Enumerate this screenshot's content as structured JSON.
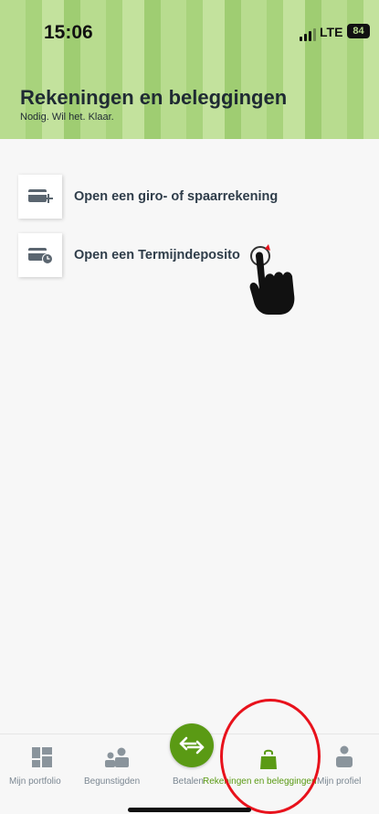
{
  "status_bar": {
    "time": "15:06",
    "network": "LTE",
    "battery": "84"
  },
  "header": {
    "title": "Rekeningen en beleggingen",
    "subtitle": "Nodig. Wil het. Klaar."
  },
  "options": [
    {
      "label": "Open een giro- of spaarrekening",
      "icon": "card-plus-icon"
    },
    {
      "label": "Open een Termijndeposito",
      "icon": "card-clock-icon"
    }
  ],
  "bottom_nav": {
    "items": [
      {
        "label": "Mijn portfolio",
        "icon": "portfolio-grid-icon"
      },
      {
        "label": "Begunstigden",
        "icon": "people-icon"
      },
      {
        "label": "Betalen",
        "icon": "transfer-arrows-icon"
      },
      {
        "label": "Rekeningen en beleggingen",
        "icon": "bag-icon",
        "active": true
      },
      {
        "label": "Mijn profiel",
        "icon": "person-icon"
      }
    ]
  },
  "colors": {
    "accent": "#5a9a14",
    "header_green": "#b8dc8f",
    "annotation_red": "#e8121c"
  }
}
